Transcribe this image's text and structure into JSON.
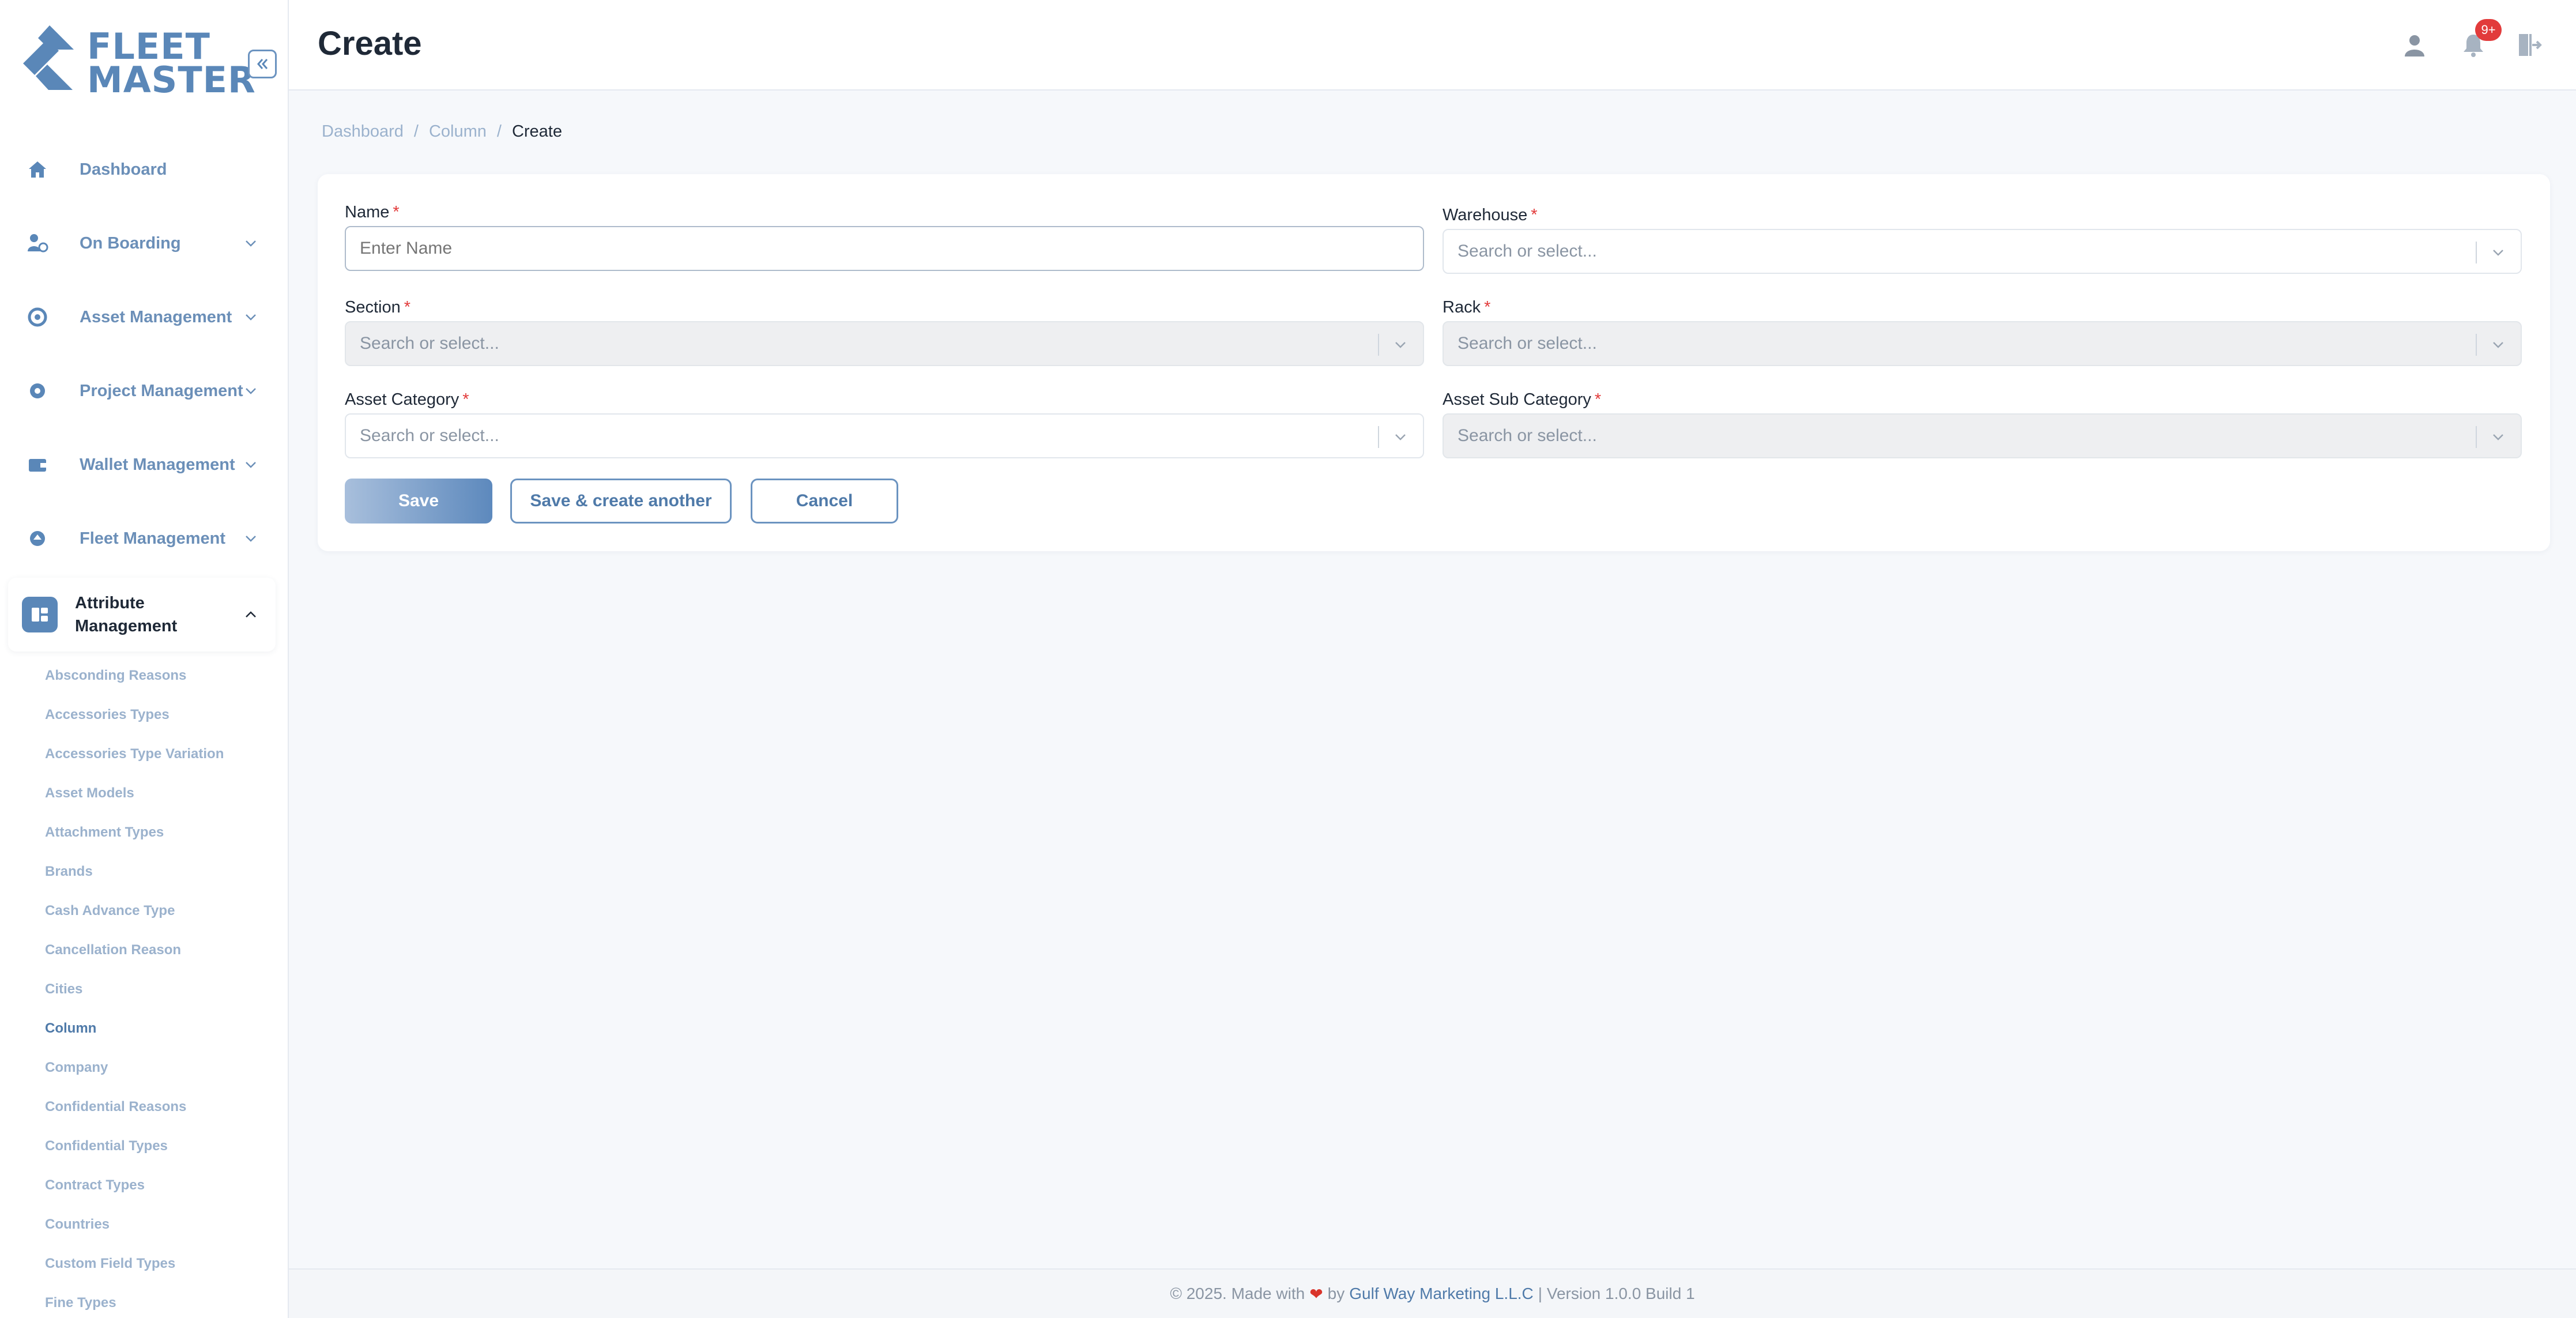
{
  "brand": {
    "line1": "FLEET",
    "line2": "MASTER",
    "color": "#5a87b8"
  },
  "sidebar": {
    "items": [
      {
        "label": "Dashboard",
        "icon": "home-icon",
        "expandable": false
      },
      {
        "label": "On Boarding",
        "icon": "onboarding-icon",
        "expandable": true
      },
      {
        "label": "Asset Management",
        "icon": "asset-icon",
        "expandable": true
      },
      {
        "label": "Project Management",
        "icon": "project-icon",
        "expandable": true
      },
      {
        "label": "Wallet Management",
        "icon": "wallet-icon",
        "expandable": true
      },
      {
        "label": "Fleet Management",
        "icon": "fleet-icon",
        "expandable": true
      },
      {
        "label": "Attribute Management",
        "icon": "attribute-icon",
        "expandable": true,
        "active": true
      }
    ],
    "submenu": [
      "Absconding Reasons",
      "Accessories Types",
      "Accessories Type Variation",
      "Asset Models",
      "Attachment Types",
      "Brands",
      "Cash Advance Type",
      "Cancellation Reason",
      "Cities",
      "Column",
      "Company",
      "Confidential Reasons",
      "Confidential Types",
      "Contract Types",
      "Countries",
      "Custom Field Types",
      "Fine Types"
    ],
    "current_submenu": "Column"
  },
  "header": {
    "title": "Create",
    "notification_count": "9+"
  },
  "breadcrumb": [
    "Dashboard",
    "Column",
    "Create"
  ],
  "form": {
    "name": {
      "label": "Name",
      "required": "*",
      "placeholder": "Enter Name"
    },
    "warehouse": {
      "label": "Warehouse",
      "required": "*",
      "placeholder": "Search or select..."
    },
    "section": {
      "label": "Section",
      "required": "*",
      "placeholder": "Search or select..."
    },
    "rack": {
      "label": "Rack",
      "required": "*",
      "placeholder": "Search or select..."
    },
    "asset_category": {
      "label": "Asset Category",
      "required": "*",
      "placeholder": "Search or select..."
    },
    "asset_sub_category": {
      "label": "Asset Sub Category",
      "required": "*",
      "placeholder": "Search or select..."
    }
  },
  "buttons": {
    "save": "Save",
    "save_another": "Save & create another",
    "cancel": "Cancel"
  },
  "footer": {
    "prefix": "© 2025. Made with",
    "by": "by",
    "company": "Gulf Way Marketing L.L.C",
    "version": "| Version 1.0.0 Build 1"
  }
}
